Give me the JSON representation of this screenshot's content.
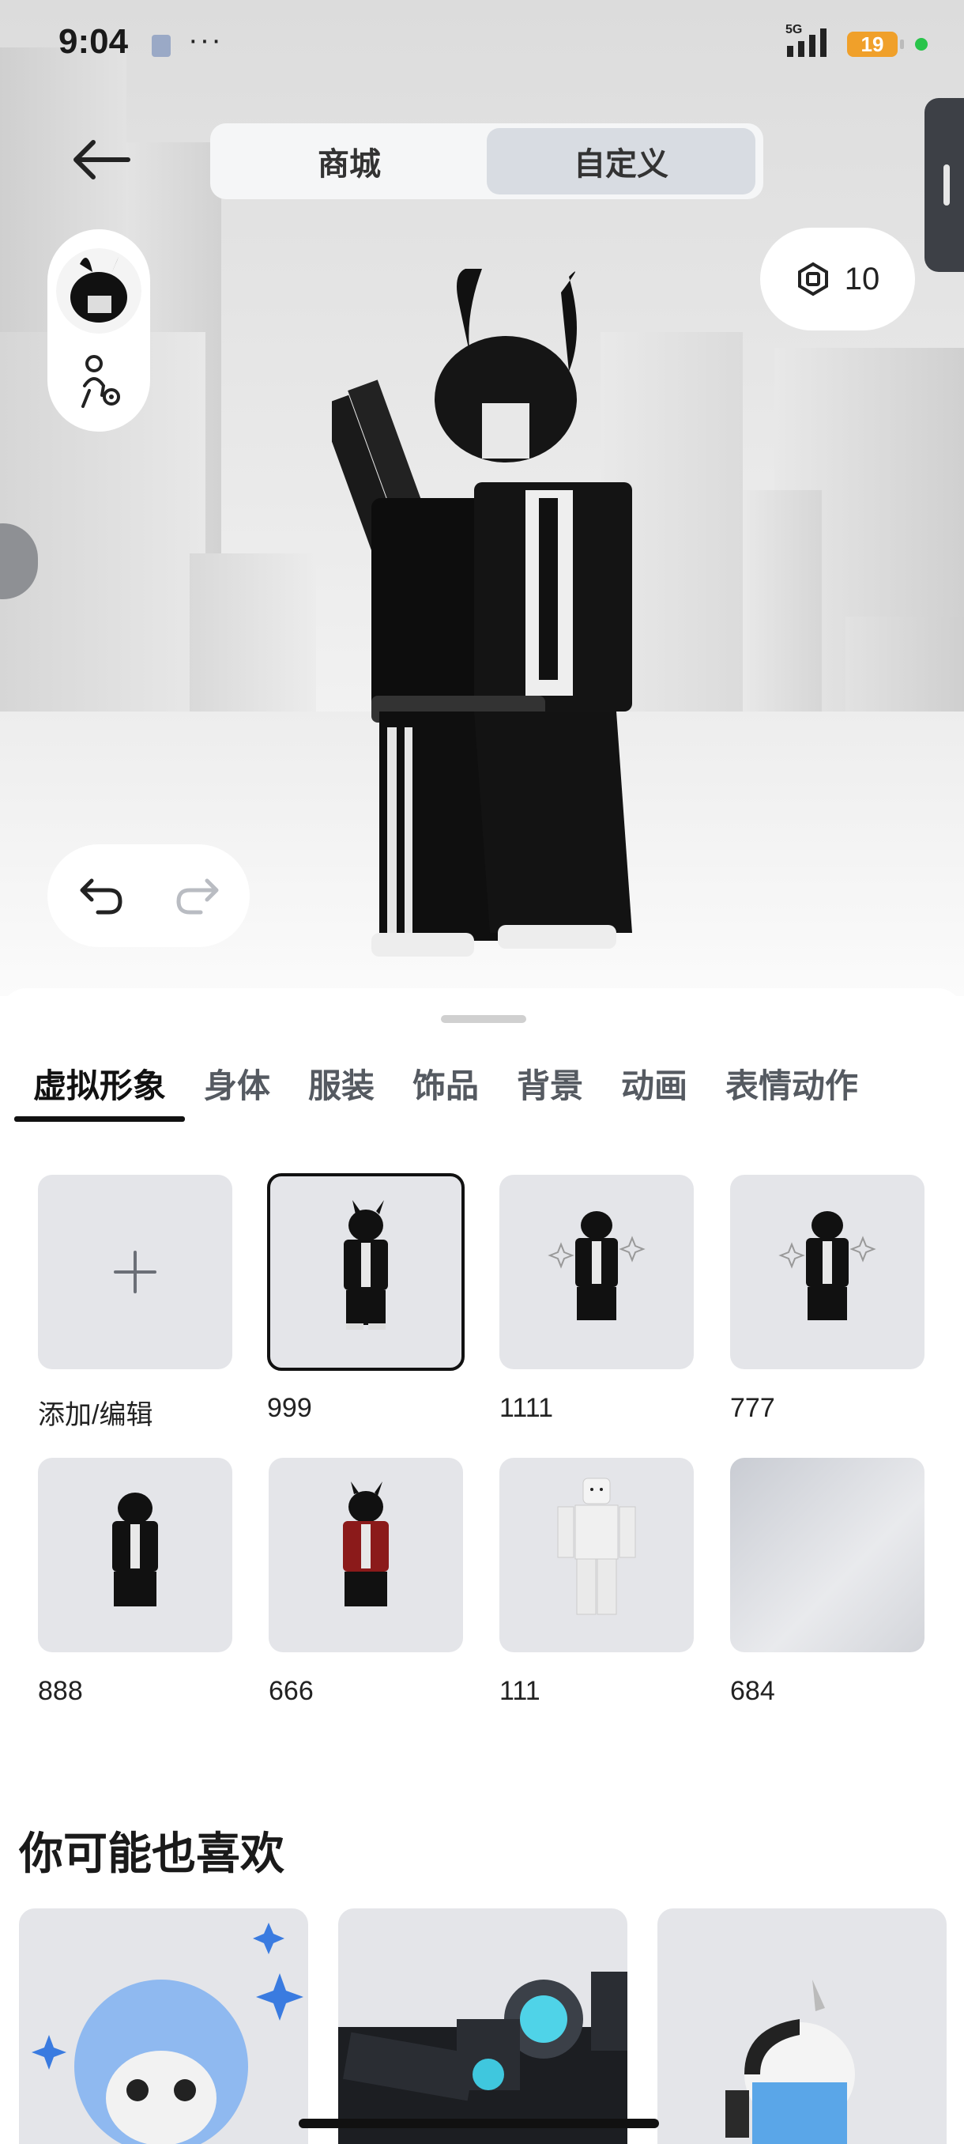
{
  "status_bar": {
    "time": "9:04",
    "more": "···",
    "network": "5G",
    "battery": "19"
  },
  "header": {
    "tabs": [
      {
        "label": "商城",
        "active": false
      },
      {
        "label": "自定义",
        "active": true
      }
    ]
  },
  "robux": {
    "amount": "10",
    "icon": "robux-icon"
  },
  "category_tabs": [
    {
      "label": "虚拟形象",
      "active": true
    },
    {
      "label": "身体",
      "active": false
    },
    {
      "label": "服装",
      "active": false
    },
    {
      "label": "饰品",
      "active": false
    },
    {
      "label": "背景",
      "active": false
    },
    {
      "label": "动画",
      "active": false
    },
    {
      "label": "表情动作",
      "active": false
    }
  ],
  "outfits": [
    {
      "label": "添加/编辑",
      "type": "add"
    },
    {
      "label": "999",
      "selected": true
    },
    {
      "label": "1111"
    },
    {
      "label": "777"
    },
    {
      "label": "888"
    },
    {
      "label": "666"
    },
    {
      "label": "111"
    },
    {
      "label": "684"
    }
  ],
  "recommend": {
    "title": "你可能也喜欢",
    "count": 3
  },
  "colors": {
    "accent": "#111111",
    "card_bg": "#e4e5e9",
    "battery": "#f0a02a",
    "status_dot": "#29c44a"
  }
}
